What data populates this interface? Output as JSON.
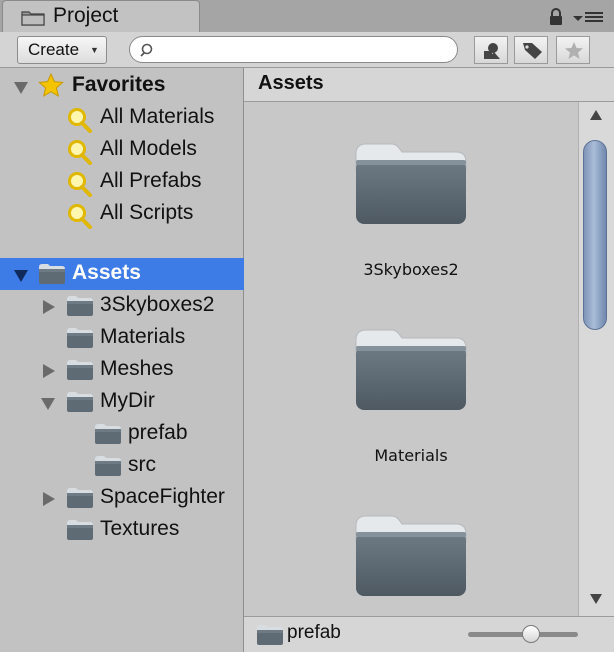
{
  "tab": {
    "title": "Project",
    "icon": "folder-icon"
  },
  "toolbar": {
    "create_label": "Create",
    "search": {
      "value": "",
      "placeholder": ""
    },
    "buttons": [
      "filter-by-type-icon",
      "filter-by-label-icon",
      "favorites-star-icon"
    ]
  },
  "sidebar": {
    "favorites": {
      "label": "Favorites",
      "items": [
        {
          "label": "All Materials"
        },
        {
          "label": "All Models"
        },
        {
          "label": "All Prefabs"
        },
        {
          "label": "All Scripts"
        }
      ]
    },
    "assets": {
      "label": "Assets",
      "items": [
        {
          "label": "3Skyboxes2"
        },
        {
          "label": "Materials"
        },
        {
          "label": "Meshes"
        },
        {
          "label": "MyDir"
        },
        {
          "label": "prefab"
        },
        {
          "label": "src"
        },
        {
          "label": "SpaceFighter"
        },
        {
          "label": "Textures"
        }
      ]
    }
  },
  "main": {
    "title": "Assets",
    "items": [
      {
        "label": "3Skyboxes2"
      },
      {
        "label": "Materials"
      },
      {
        "label": ""
      }
    ]
  },
  "footer": {
    "selected_label": "prefab"
  },
  "colors": {
    "selection": "#3d7ce6",
    "folder": "#5f6b74",
    "star": "#f5c400"
  }
}
